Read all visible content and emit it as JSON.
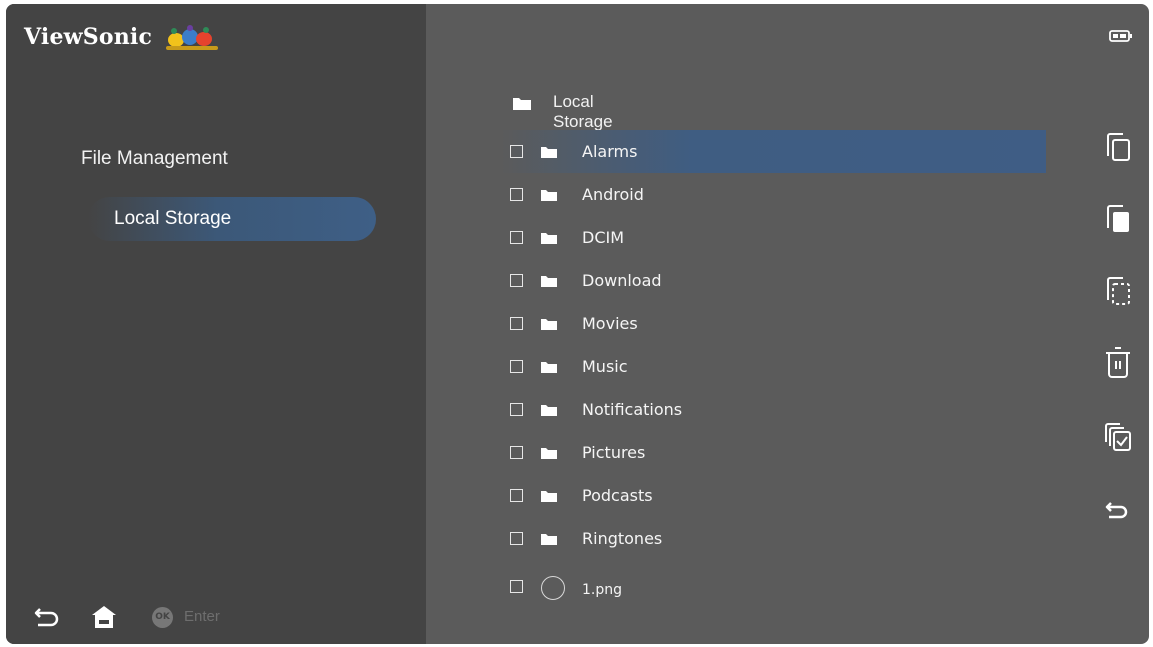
{
  "brand": {
    "name": "ViewSonic"
  },
  "sidebar": {
    "title": "File Management",
    "items": [
      {
        "label": "Local Storage",
        "selected": true
      }
    ]
  },
  "bottom_bar": {
    "ok_badge": "OK",
    "enter_label": "Enter",
    "icons": [
      "back-icon",
      "home-icon",
      "ok-button-icon"
    ]
  },
  "status": {
    "icons": [
      "battery-icon"
    ]
  },
  "content": {
    "path_label": "Local Storage",
    "files": [
      {
        "label": "Alarms",
        "selected": true
      },
      {
        "label": "Android"
      },
      {
        "label": "DCIM"
      },
      {
        "label": "Download"
      },
      {
        "label": "Movies"
      },
      {
        "label": "Music"
      },
      {
        "label": "Notifications"
      },
      {
        "label": "Pictures"
      },
      {
        "label": "Podcasts"
      },
      {
        "label": "Ringtones"
      }
    ],
    "partial_item_label": "1.png"
  },
  "actions": [
    "copy-icon",
    "paste-icon",
    "select-area-icon",
    "delete-icon",
    "select-all-icon",
    "return-icon"
  ],
  "colors": {
    "sidebar_bg": "#444444",
    "content_bg": "#5b5b5b",
    "highlight": "#3f5d85",
    "text": "#f5f5f5"
  }
}
